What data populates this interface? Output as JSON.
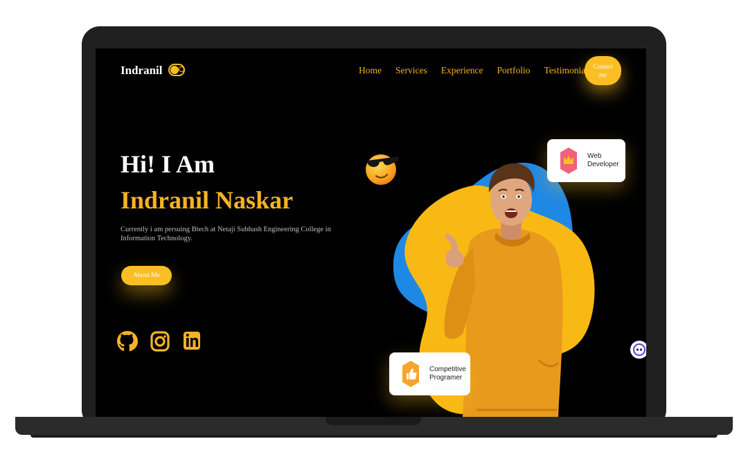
{
  "header": {
    "brand": "Indranil",
    "nav": [
      "Home",
      "Services",
      "Experience",
      "Portfolio",
      "Testimonials"
    ],
    "contact_label": "Contact me"
  },
  "hero": {
    "greeting": "Hi! I Am",
    "name": "Indranil Naskar",
    "description": "Currently i am persuing Btech at Netaji Subhash Engineering College in Information Technology.",
    "about_label": "About Me"
  },
  "social": [
    "github-icon",
    "instagram-icon",
    "linkedin-icon"
  ],
  "cards": {
    "web": "Web Developer",
    "cp_line1": "Competitive",
    "cp_line2": "Programer"
  },
  "colors": {
    "accent": "#fbbf24",
    "blue": "#1e88e5",
    "background": "#000000"
  }
}
